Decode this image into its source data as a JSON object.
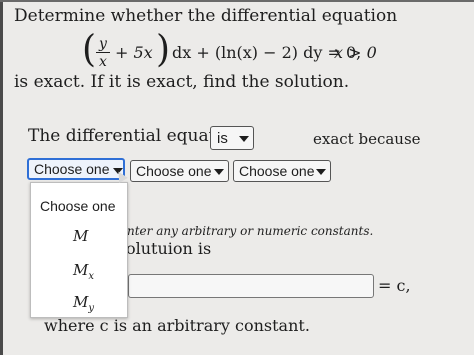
{
  "problem": {
    "line1": "Determine whether the differential equation",
    "eq_frac_num": "y",
    "eq_frac_den": "x",
    "eq_plus5x": "+ 5x",
    "eq_dx_part": "dx + (ln(x) − 2) dy = 0,",
    "eq_condition": "x > 0",
    "line2": "is exact. If it is exact, find the solution."
  },
  "statement": {
    "text": "The differential equation",
    "is_select_value": "is",
    "because_text": "exact because"
  },
  "selects": {
    "sel1": "Choose one",
    "sel2": "Choose one",
    "sel3": "Choose one"
  },
  "dropdown": {
    "header": "Choose one",
    "options": [
      {
        "main": "M",
        "sub": ""
      },
      {
        "main": "M",
        "sub": "x"
      },
      {
        "main": "M",
        "sub": "y"
      }
    ]
  },
  "partial": {
    "italic_text": "nter any arbitrary or numeric constants.",
    "solution_text": "olutuion is"
  },
  "answer": {
    "equals_c": "= c,",
    "where_text": "where c is an arbitrary constant."
  }
}
